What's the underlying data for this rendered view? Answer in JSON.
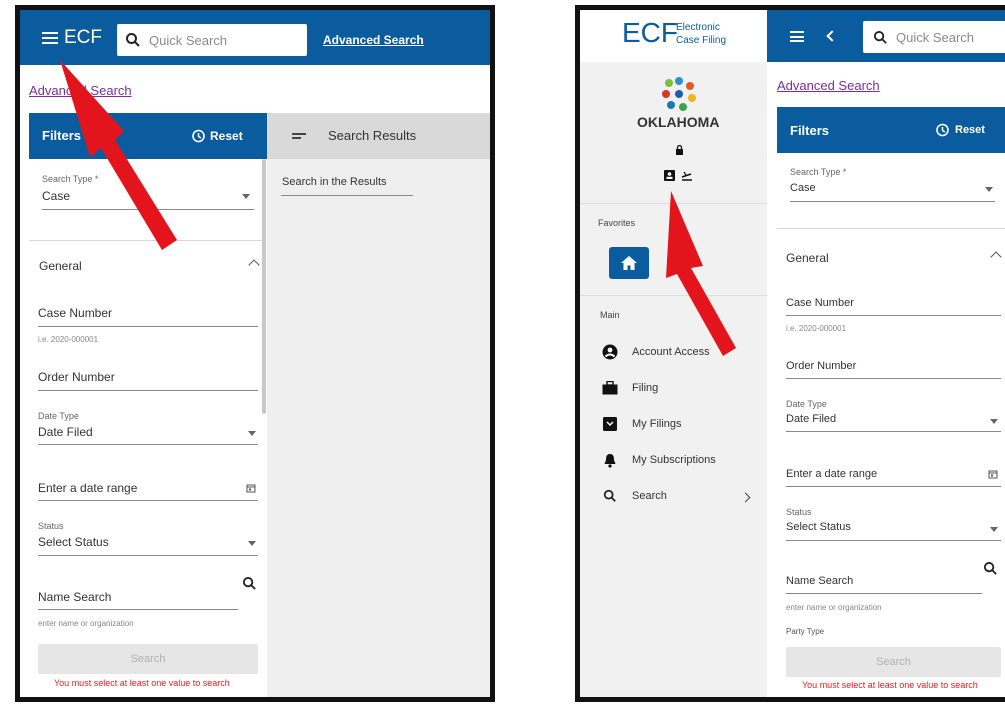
{
  "left": {
    "app_name": "ECF",
    "quick_search_placeholder": "Quick Search",
    "advanced_search_top": "Advanced Search",
    "advanced_search_link": "Advanced Search",
    "filters_title": "Filters",
    "reset_label": "Reset",
    "search_results_title": "Search Results",
    "search_in_results_placeholder": "Search in the Results",
    "search_type_label": "Search Type *",
    "search_type_value": "Case",
    "general_label": "General",
    "case_number_label": "Case Number",
    "case_number_hint": "i.e. 2020-000001",
    "order_number_label": "Order Number",
    "date_type_label": "Date Type",
    "date_type_value": "Date Filed",
    "date_range_placeholder": "Enter a date range",
    "status_label": "Status",
    "status_value": "Select Status",
    "name_search_label": "Name Search",
    "name_search_hint": "enter name or organization",
    "search_button": "Search",
    "warning": "You must select at least one value to search"
  },
  "right": {
    "logo_ecf": "ECF",
    "logo_line1": "Electronic",
    "logo_line2": "Case Filing",
    "state_name": "OKLAHOMA",
    "favorites_label": "Favorites",
    "main_label": "Main",
    "nav": [
      {
        "label": "Account Access",
        "icon": "account-circle-icon"
      },
      {
        "label": "Filing",
        "icon": "briefcase-icon"
      },
      {
        "label": "My Filings",
        "icon": "inbox-icon"
      },
      {
        "label": "My Subscriptions",
        "icon": "bell-icon"
      },
      {
        "label": "Search",
        "icon": "search-icon"
      }
    ],
    "quick_search_placeholder": "Quick Search",
    "advanced_search_link": "Advanced Search",
    "filters_title": "Filters",
    "reset_label": "Reset",
    "search_type_label": "Search Type *",
    "search_type_value": "Case",
    "general_label": "General",
    "case_number_label": "Case Number",
    "case_number_hint": "i.e. 2020-000001",
    "order_number_label": "Order Number",
    "date_type_label": "Date Type",
    "date_type_value": "Date Filed",
    "date_range_placeholder": "Enter a date range",
    "status_label": "Status",
    "status_value": "Select Status",
    "name_search_label": "Name Search",
    "name_search_hint": "enter name or organization",
    "party_type_label": "Party Type",
    "search_button": "Search",
    "warning": "You must select at least one value to search"
  },
  "colors": {
    "header_blue": "#0b5c9f",
    "link_purple": "#7d2c9b",
    "warning_red": "#e02020",
    "arrow_red": "#e3141b"
  }
}
